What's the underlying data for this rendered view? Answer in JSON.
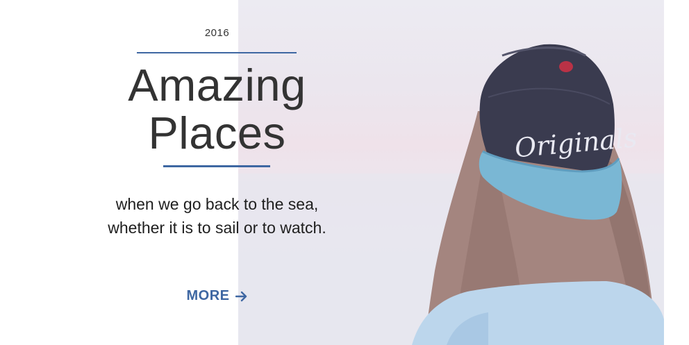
{
  "hero": {
    "year": "2016",
    "title_line1": "Amazing",
    "title_line2": "Places",
    "subtitle": "when we go back to the sea, whether it is to sail or to watch.",
    "more_label": "MORE",
    "more_icon": "arrow-right-icon"
  },
  "photo": {
    "cap_text": "Originals"
  },
  "colors": {
    "accent": "#3e67a2",
    "title_text": "#333333",
    "body_text": "#1f1f1f"
  }
}
